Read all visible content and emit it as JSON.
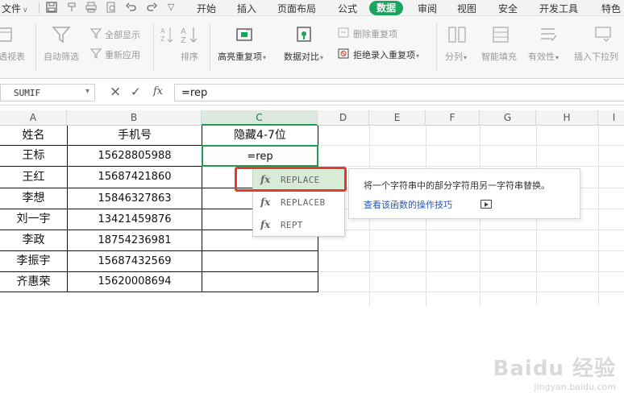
{
  "menu": {
    "file": "文件",
    "tabs": [
      "开始",
      "插入",
      "页面布局",
      "公式",
      "数据",
      "审阅",
      "视图",
      "安全",
      "开发工具",
      "特色"
    ],
    "active_tab": "数据"
  },
  "ribbon": {
    "pivot": "透视表",
    "auto_filter": "自动筛选",
    "show_all": "全部显示",
    "reapply": "重新应用",
    "sort": "排序",
    "highlight_dup": "高亮重复项",
    "compare": "数据对比",
    "remove_dup": "删除重复项",
    "reject_dup": "拒绝录入重复项",
    "split": "分列",
    "smart_fill": "智能填充",
    "validity": "有效性",
    "dropdown": "插入下拉列"
  },
  "formula_bar": {
    "name_box": "SUMIF",
    "fx": "fx",
    "value": "=rep"
  },
  "sheet": {
    "columns": [
      "A",
      "B",
      "C",
      "D",
      "E",
      "F",
      "G",
      "H",
      "I"
    ],
    "selected_column": "C",
    "header_row": [
      "姓名",
      "手机号",
      "隐藏4-7位"
    ],
    "rows": [
      [
        "王标",
        "15628805988",
        "=rep"
      ],
      [
        "王红",
        "15687421860",
        ""
      ],
      [
        "李想",
        "15846327863",
        ""
      ],
      [
        "刘一宇",
        "13421459876",
        ""
      ],
      [
        "李政",
        "18754236981",
        ""
      ],
      [
        "李振宇",
        "15687432569",
        ""
      ],
      [
        "齐惠荣",
        "15620008694",
        ""
      ]
    ]
  },
  "autocomplete": {
    "items": [
      "REPLACE",
      "REPLACEB",
      "REPT"
    ],
    "selected": "REPLACE",
    "fx": "fx"
  },
  "tooltip": {
    "description": "将一个字符串中的部分字符用另一字符串替换。",
    "link": "查看该函数的操作技巧"
  },
  "watermark": {
    "brand": "Baidu 经验",
    "url": "jingyan.baidu.com"
  },
  "colors": {
    "accent": "#1aa55f",
    "highlight_red": "#e5392b",
    "link": "#2456b8"
  }
}
